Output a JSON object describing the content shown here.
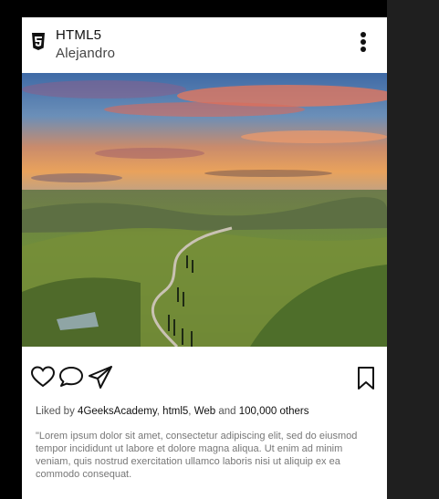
{
  "post": {
    "title": "HTML5",
    "author": "Alejandro",
    "liked_prefix": "Liked by",
    "liked_user1": "4GeeksAcademy",
    "liked_sep1": ",",
    "liked_user2": "html5",
    "liked_sep2": ",",
    "liked_user3": "Web",
    "liked_and": "and",
    "liked_count": "100,000 others",
    "caption": "\"Lorem ipsum dolor sit amet, consectetur adipiscing elit, sed do eiusmod tempor incididunt ut labore et dolore magna aliqua. Ut enim ad minim veniam, quis nostrud exercitation ullamco laboris nisi ut aliquip ex ea commodo consequat."
  },
  "icons": {
    "logo": "html5-icon",
    "menu": "vertical-dots-icon",
    "like": "heart-icon",
    "comment": "comment-icon",
    "share": "paper-plane-icon",
    "save": "bookmark-icon"
  },
  "colors": {
    "card_bg": "#ffffff",
    "page_bg": "#000000",
    "side_bg": "#1f1f1f",
    "text_main": "#111111",
    "text_muted": "#777777"
  }
}
